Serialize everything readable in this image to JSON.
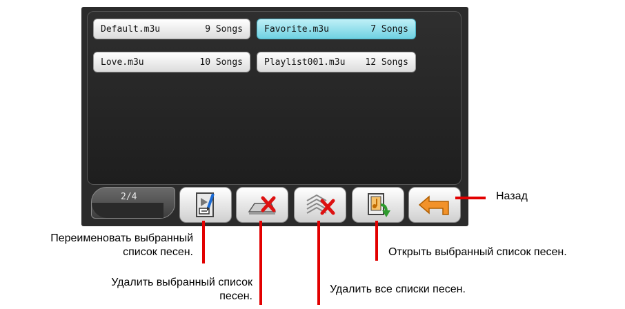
{
  "playlists": [
    {
      "name": "Default.m3u",
      "songs": "9 Songs",
      "selected": false
    },
    {
      "name": "Favorite.m3u",
      "songs": "7 Songs",
      "selected": true
    },
    {
      "name": "Love.m3u",
      "songs": "10 Songs",
      "selected": false
    },
    {
      "name": "Playlist001.m3u",
      "songs": "12 Songs",
      "selected": false
    }
  ],
  "pager": {
    "indicator": "2/4"
  },
  "toolbar": {
    "rename_icon": "rename-playlist-icon",
    "delete_icon": "delete-playlist-icon",
    "delete_all_icon": "delete-all-playlists-icon",
    "open_icon": "open-playlist-icon",
    "back_icon": "back-arrow-icon"
  },
  "callouts": {
    "back": "Назад",
    "rename_line1": "Переименовать выбранный",
    "rename_line2": "список песен.",
    "open": "Открыть выбранный список песен.",
    "delete_line1": "Удалить выбранный список",
    "delete_line2": "песен.",
    "delete_all": "Удалить все списки песен."
  },
  "colors": {
    "selected": "#6fd1e2",
    "callout_line": "#e20000",
    "device_bg": "#2b2b2b"
  }
}
